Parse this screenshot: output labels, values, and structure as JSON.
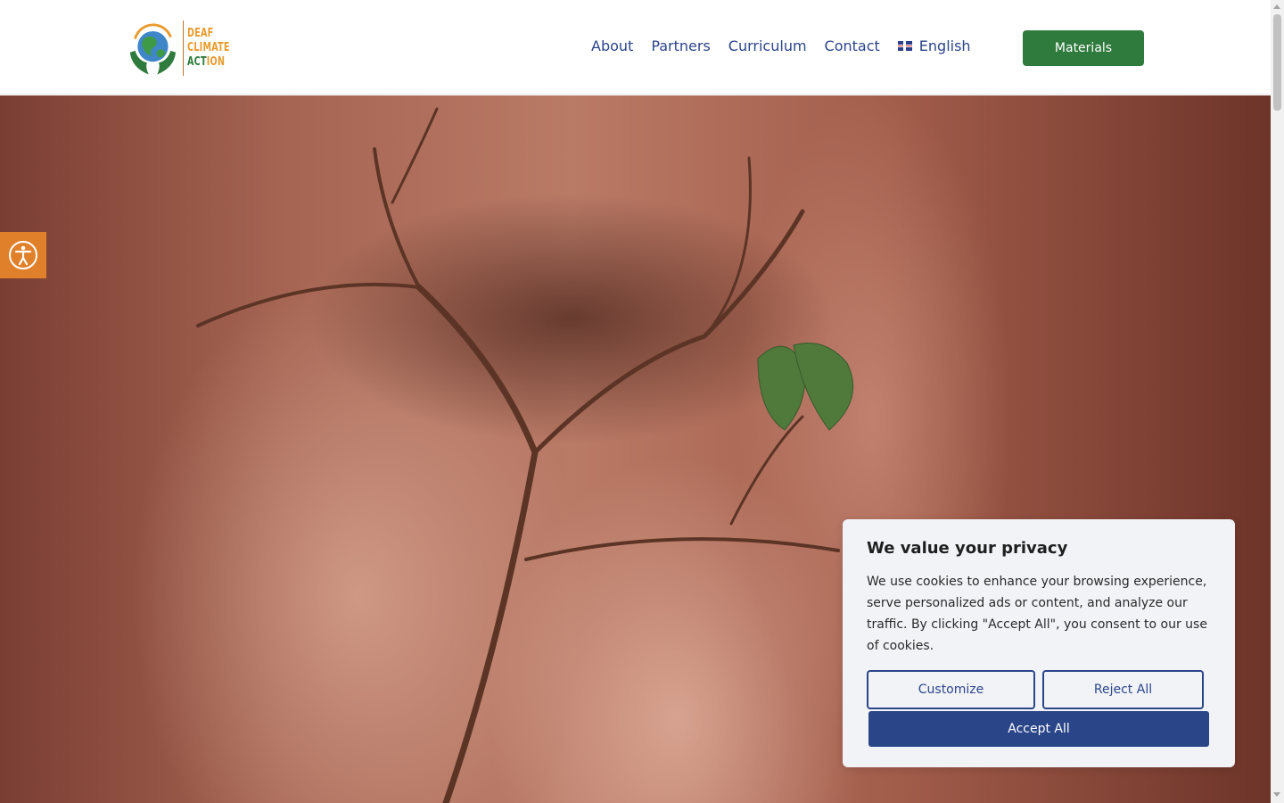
{
  "header": {
    "logo": {
      "line1": "DEAF",
      "line2": "CLIMATE",
      "line3_green": "ACT",
      "line3_orange": "ION"
    },
    "nav": [
      {
        "label": "About"
      },
      {
        "label": "Partners"
      },
      {
        "label": "Curriculum"
      },
      {
        "label": "Contact"
      }
    ],
    "language": {
      "label": "English",
      "flag_icon": "uk-flag-icon"
    },
    "materials_label": "Materials"
  },
  "accessibility_button": {
    "icon": "accessibility-icon",
    "color": "#e0802a"
  },
  "cookie_banner": {
    "title": "We value your privacy",
    "text": "We use cookies to enhance your browsing experience, serve personalized ads or content, and analyze our traffic. By clicking \"Accept All\", you consent to our use of cookies.",
    "customize_label": "Customize",
    "reject_label": "Reject All",
    "accept_label": "Accept All"
  },
  "colors": {
    "brand_green": "#2f7a3d",
    "brand_blue": "#2b4589",
    "brand_orange": "#e99a2c"
  }
}
